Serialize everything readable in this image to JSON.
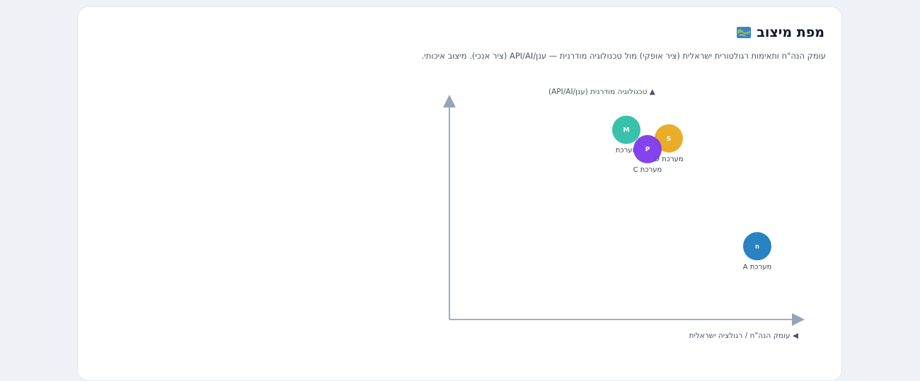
{
  "header": {
    "title": "מפת מיצוב",
    "subtitle": "עומק הנה\"ח ותאימות רגולטורית ישראלית (ציר אופקי) מול טכנולוגיה מודרנית — ענן/API/AI (ציר אנכי). מיצוב איכותי.",
    "icon": "map-icon"
  },
  "chart_data": {
    "type": "scatter",
    "xlabel": "◀ עומק הנה\"ח / רגולציה ישראלית",
    "ylabel": "▲ טכנולוגיה מודרנית (ענן/API/AI)",
    "xlim": [
      0,
      10
    ],
    "ylim": [
      0,
      10
    ],
    "grid": false,
    "points": [
      {
        "name": "מערכת A",
        "letter": "ח",
        "x": 8.7,
        "y": 3.4,
        "color": "#1e7bbf"
      },
      {
        "name": "מערכת",
        "letter": "M",
        "x": 5.0,
        "y": 8.8,
        "color": "#2ebfa5"
      },
      {
        "name": "מערכת D",
        "letter": "S",
        "x": 6.2,
        "y": 8.4,
        "color": "#e9a91c"
      },
      {
        "name": "מערכת C",
        "letter": "P",
        "x": 5.6,
        "y": 7.9,
        "color": "#7c3aed"
      }
    ]
  }
}
